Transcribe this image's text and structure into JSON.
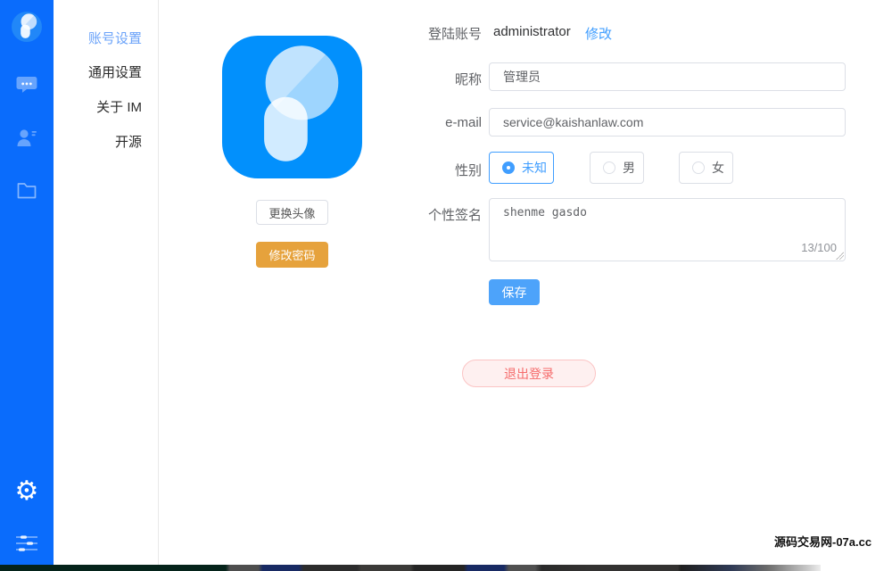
{
  "rail": {
    "bg_color": "#0a6cfc",
    "icons": [
      "app-logo",
      "chat",
      "contacts",
      "folder",
      "settings-gear",
      "sliders"
    ],
    "gear_glyph": "⚙"
  },
  "menu": {
    "active_color": "#6ba3f9",
    "items": [
      {
        "label": "账号设置",
        "active": true
      },
      {
        "label": "通用设置",
        "active": false
      },
      {
        "label": "关于 IM",
        "active": false
      },
      {
        "label": "开源",
        "active": false
      }
    ]
  },
  "profile": {
    "avatar_bg": "#0290fc",
    "change_avatar_label": "更换头像",
    "change_password_label": "修改密码",
    "password_btn_color": "#e6a23c"
  },
  "form": {
    "login_account_label": "登陆账号",
    "login_account_value": "administrator",
    "modify_link": "修改",
    "nickname_label": "昵称",
    "nickname_value": "管理员",
    "email_label": "e-mail",
    "email_value": "service@kaishanlaw.com",
    "gender_label": "性别",
    "gender_options": [
      {
        "label": "未知",
        "selected": true
      },
      {
        "label": "男",
        "selected": false
      },
      {
        "label": "女",
        "selected": false
      }
    ],
    "signature_label": "个性签名",
    "signature_value": "shenme gasdo",
    "signature_counter": "13/100",
    "save_label": "保存",
    "accent_color": "#409eff",
    "save_bg": "#4da3fa"
  },
  "logout": {
    "label": "退出登录",
    "text_color": "#f56c6c",
    "bg_color": "#fef0f0",
    "border_color": "#fbc4c4"
  },
  "watermark": "源码交易网-07a.cc"
}
